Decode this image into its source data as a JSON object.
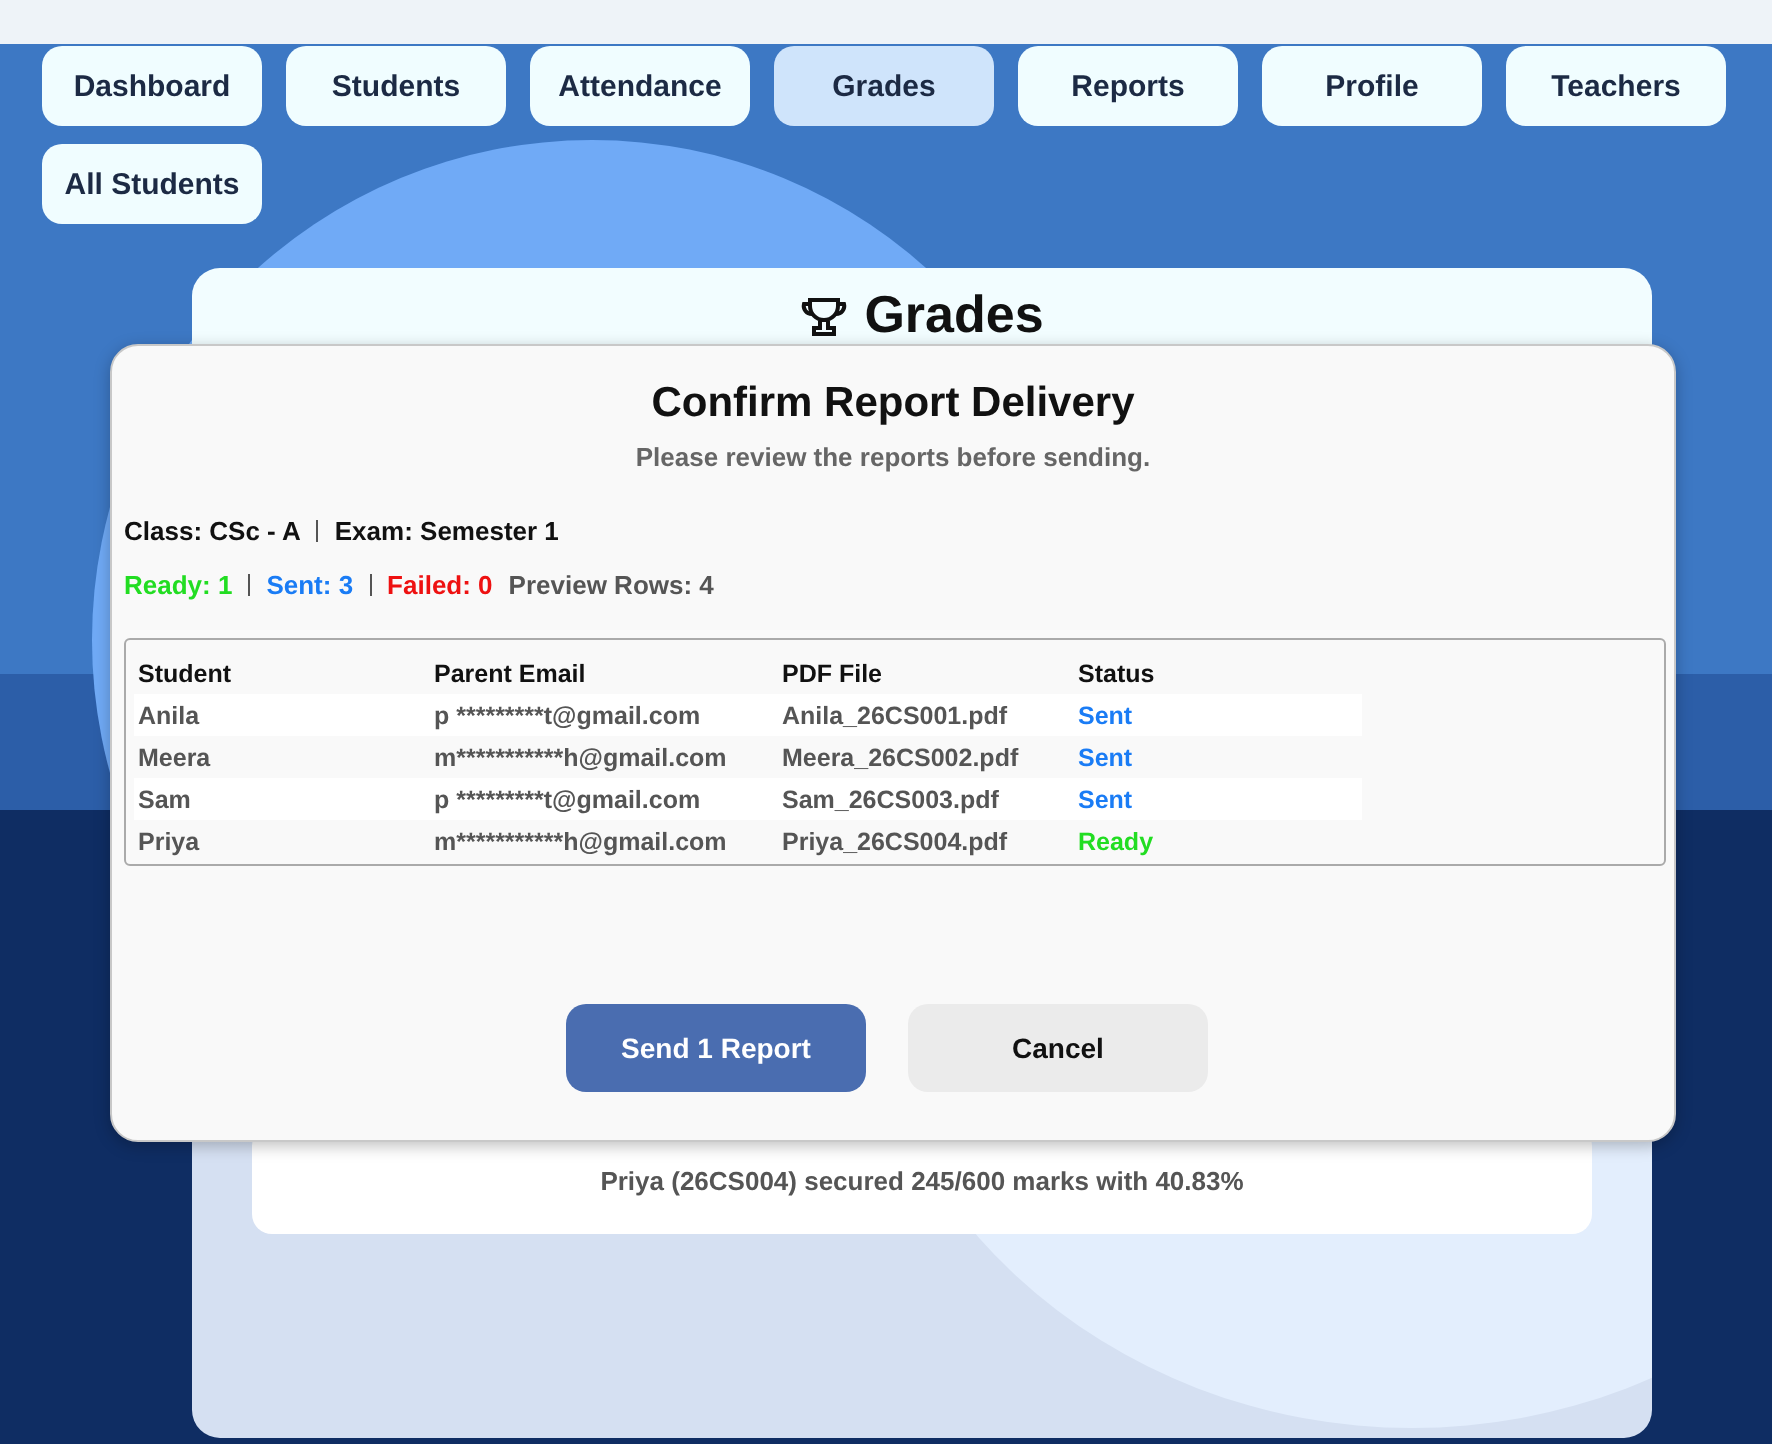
{
  "nav": [
    {
      "label": "Dashboard",
      "selected": false
    },
    {
      "label": "Students",
      "selected": false
    },
    {
      "label": "Attendance",
      "selected": false
    },
    {
      "label": "Grades",
      "selected": true
    },
    {
      "label": "Reports",
      "selected": false
    },
    {
      "label": "Profile",
      "selected": false
    },
    {
      "label": "Teachers",
      "selected": false
    },
    {
      "label": "All Students",
      "selected": false
    }
  ],
  "page": {
    "title": "Grades",
    "result": "Priya (26CS004) secured 245/600 marks with 40.83%"
  },
  "dialog": {
    "title": "Confirm Report Delivery",
    "subtitle": "Please review the reports before sending.",
    "class_label": "Class: CSc - A",
    "exam_label": "Exam: Semester 1",
    "stats": [
      {
        "kind": "ready",
        "text": "Ready: 1"
      },
      {
        "kind": "sent",
        "text": "Sent: 3"
      },
      {
        "kind": "failed",
        "text": "Failed: 0"
      },
      {
        "kind": "info",
        "text": "Preview Rows: 4"
      }
    ],
    "columns": [
      "Student",
      "Parent Email",
      "PDF File",
      "Status"
    ],
    "rows": [
      {
        "student": "Anila",
        "email": "p *********t@gmail.com",
        "file": "Anila_26CS001.pdf",
        "status": "Sent",
        "kind": "sent"
      },
      {
        "student": "Meera",
        "email": "m***********h@gmail.com",
        "file": "Meera_26CS002.pdf",
        "status": "Sent",
        "kind": "sent"
      },
      {
        "student": "Sam",
        "email": "p *********t@gmail.com",
        "file": "Sam_26CS003.pdf",
        "status": "Sent",
        "kind": "sent"
      },
      {
        "student": "Priya",
        "email": "m***********h@gmail.com",
        "file": "Priya_26CS004.pdf",
        "status": "Ready",
        "kind": "ready"
      }
    ],
    "buttons": [
      {
        "kind": "primary",
        "label": "Send 1 Report"
      },
      {
        "kind": "secondary",
        "label": "Cancel"
      }
    ]
  }
}
